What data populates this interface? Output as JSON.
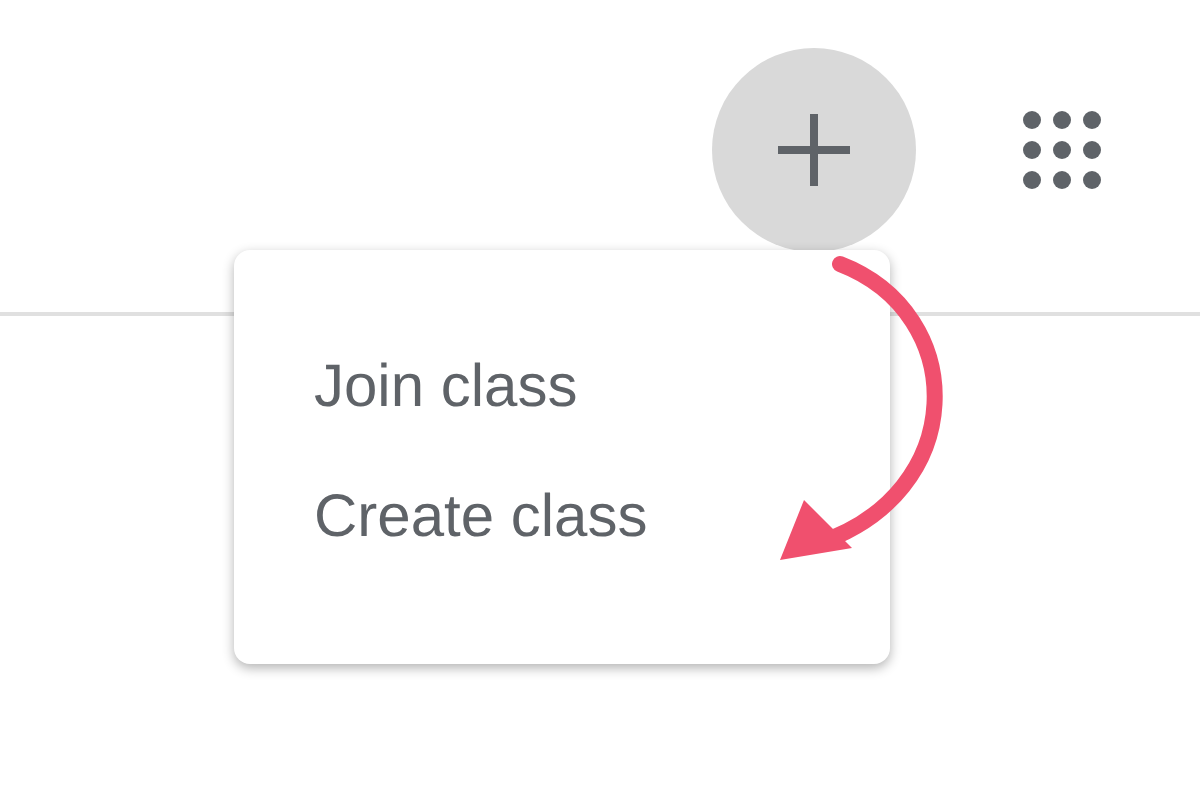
{
  "menu": {
    "items": [
      {
        "label": "Join class"
      },
      {
        "label": "Create class"
      }
    ]
  }
}
